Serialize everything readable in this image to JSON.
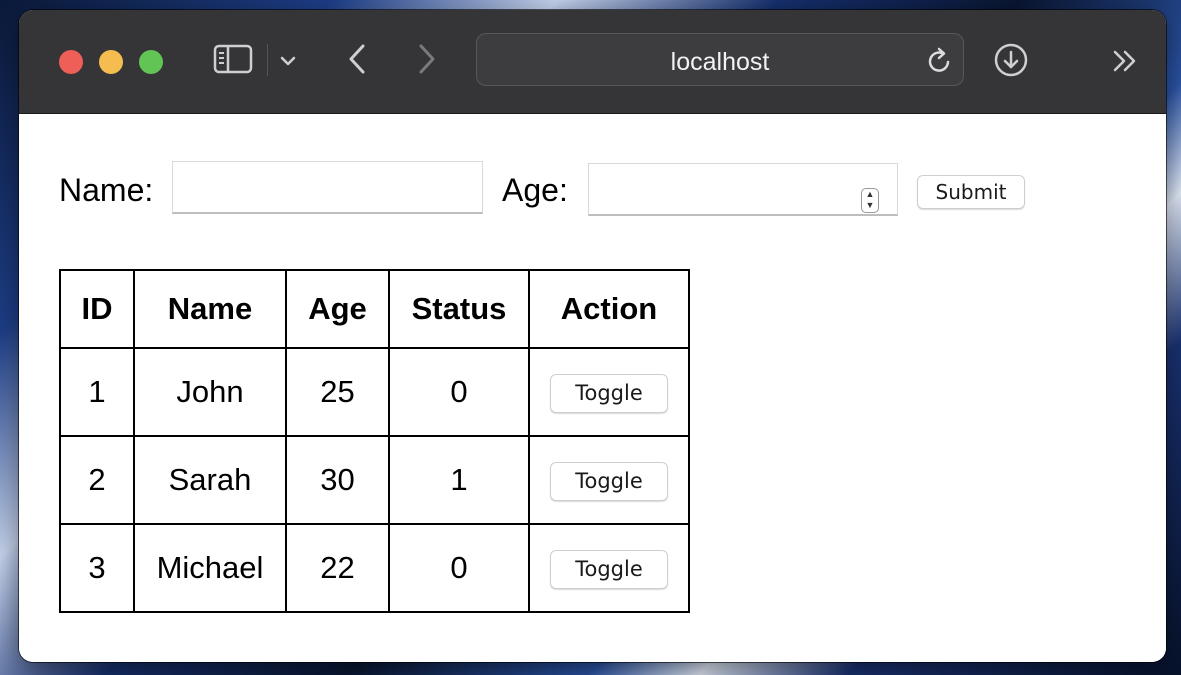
{
  "browser": {
    "address": "localhost"
  },
  "form": {
    "name_label": "Name:",
    "name_value": "",
    "age_label": "Age:",
    "age_value": "",
    "submit_label": "Submit"
  },
  "table": {
    "headers": [
      "ID",
      "Name",
      "Age",
      "Status",
      "Action"
    ],
    "rows": [
      {
        "id": "1",
        "name": "John",
        "age": "25",
        "status": "0",
        "action": "Toggle"
      },
      {
        "id": "2",
        "name": "Sarah",
        "age": "30",
        "status": "1",
        "action": "Toggle"
      },
      {
        "id": "3",
        "name": "Michael",
        "age": "22",
        "status": "0",
        "action": "Toggle"
      }
    ]
  },
  "colors": {
    "titlebar": "#353537",
    "close": "#ee5f57",
    "minimize": "#f5bd4f",
    "maximize": "#61c454"
  }
}
